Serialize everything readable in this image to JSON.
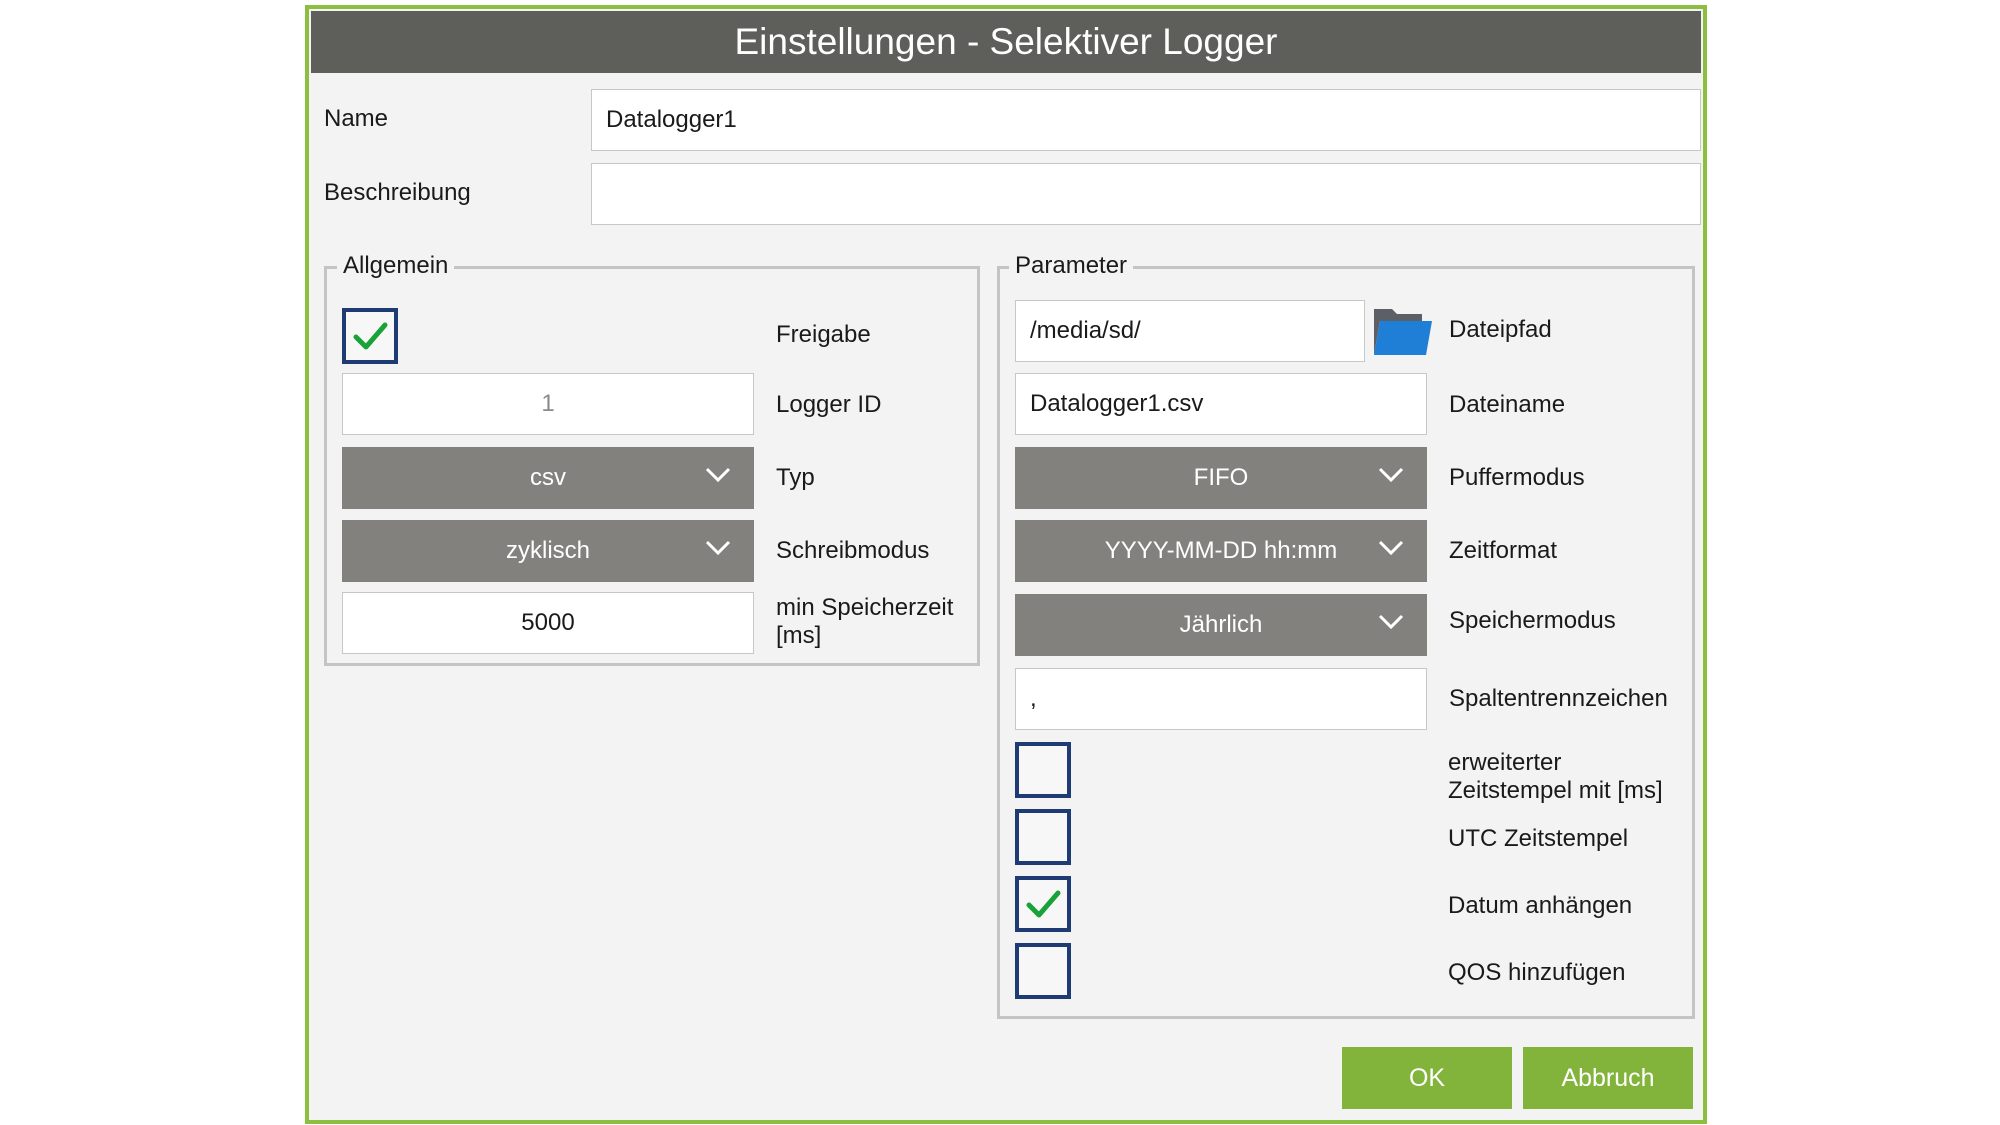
{
  "dialog": {
    "title": "Einstellungen - Selektiver Logger"
  },
  "top_fields": {
    "name_label": "Name",
    "name_value": "Datalogger1",
    "beschreibung_label": "Beschreibung",
    "beschreibung_value": ""
  },
  "allgemein": {
    "legend": "Allgemein",
    "freigabe_label": "Freigabe",
    "freigabe_checked": true,
    "logger_id_value": "1",
    "logger_id_label": "Logger ID",
    "typ_value": "csv",
    "typ_label": "Typ",
    "schreibmodus_value": "zyklisch",
    "schreibmodus_label": "Schreibmodus",
    "min_speicherzeit_value": "5000",
    "min_speicherzeit_label_line1": "min Speicherzeit",
    "min_speicherzeit_label_line2": "[ms]"
  },
  "parameter": {
    "legend": "Parameter",
    "dateipfad_value": "/media/sd/",
    "dateipfad_label": "Dateipfad",
    "folder_icon": "folder-icon",
    "dateiname_value": "Datalogger1.csv",
    "dateiname_label": "Dateiname",
    "puffermodus_value": "FIFO",
    "puffermodus_label": "Puffermodus",
    "zeitformat_value": "YYYY-MM-DD hh:mm",
    "zeitformat_label": "Zeitformat",
    "speichermodus_value": "Jährlich",
    "speichermodus_label": "Speichermodus",
    "spaltentrenn_value": ",",
    "spaltentrenn_label": "Spaltentrennzeichen",
    "erweitert_label_line1": "erweiterter",
    "erweitert_label_line2": "Zeitstempel mit [ms]",
    "erweitert_checked": false,
    "utc_label": "UTC Zeitstempel",
    "utc_checked": false,
    "datum_label": "Datum anhängen",
    "datum_checked": true,
    "qos_label": "QOS hinzufügen",
    "qos_checked": false
  },
  "buttons": {
    "ok": "OK",
    "abbruch": "Abbruch"
  },
  "colors": {
    "accent_green": "#8cbf3f",
    "button_green": "#82b43c",
    "title_bar": "#5e5e5a",
    "dropdown_bg": "#82817e",
    "checkbox_border": "#1f3b73",
    "checkmark": "#1aa23a",
    "folder_blue": "#1f7fd6"
  }
}
